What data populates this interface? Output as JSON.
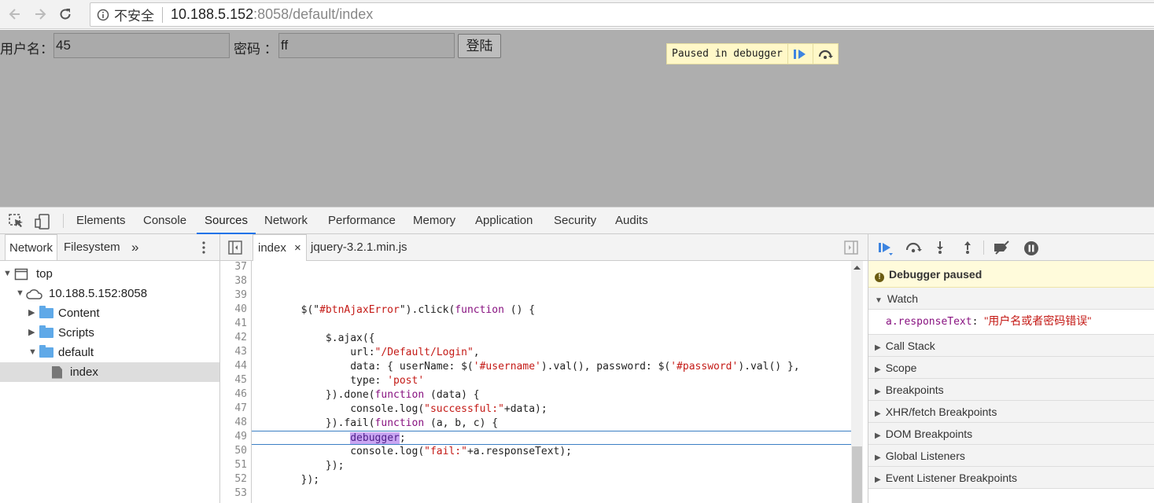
{
  "browser": {
    "security_label": "不安全",
    "url_host": "10.188.5.152",
    "url_port_path": ":8058/default/index"
  },
  "page": {
    "username_label": "用户名：",
    "username_value": "45",
    "password_label": "密码 ：",
    "password_value": "ff",
    "login_button": "登陆",
    "paused_overlay": "Paused in debugger"
  },
  "devtools": {
    "tabs": [
      "Elements",
      "Console",
      "Sources",
      "Network",
      "Performance",
      "Memory",
      "Application",
      "Security",
      "Audits"
    ],
    "active_tab": "Sources",
    "navigator": {
      "tabs": [
        "Network",
        "Filesystem"
      ],
      "more": "»",
      "tree": {
        "top": "top",
        "host": "10.188.5.152:8058",
        "content": "Content",
        "scripts": "Scripts",
        "default": "default",
        "index": "index"
      }
    },
    "editor": {
      "tabs": [
        "index",
        "jquery-3.2.1.min.js"
      ],
      "close": "×",
      "line_numbers": [
        "37",
        "38",
        "39",
        "40",
        "41",
        "42",
        "43",
        "44",
        "45",
        "46",
        "47",
        "48",
        "49",
        "50",
        "51",
        "52",
        "53"
      ]
    },
    "sidebar": {
      "paused_title": "Debugger paused",
      "watch_title": "Watch",
      "watch_expr": "a.responseText",
      "watch_colon": ": ",
      "watch_value": "\"用户名或者密码错误\"",
      "sections": [
        "Call Stack",
        "Scope",
        "Breakpoints",
        "XHR/fetch Breakpoints",
        "DOM Breakpoints",
        "Global Listeners",
        "Event Listener Breakpoints"
      ]
    }
  }
}
